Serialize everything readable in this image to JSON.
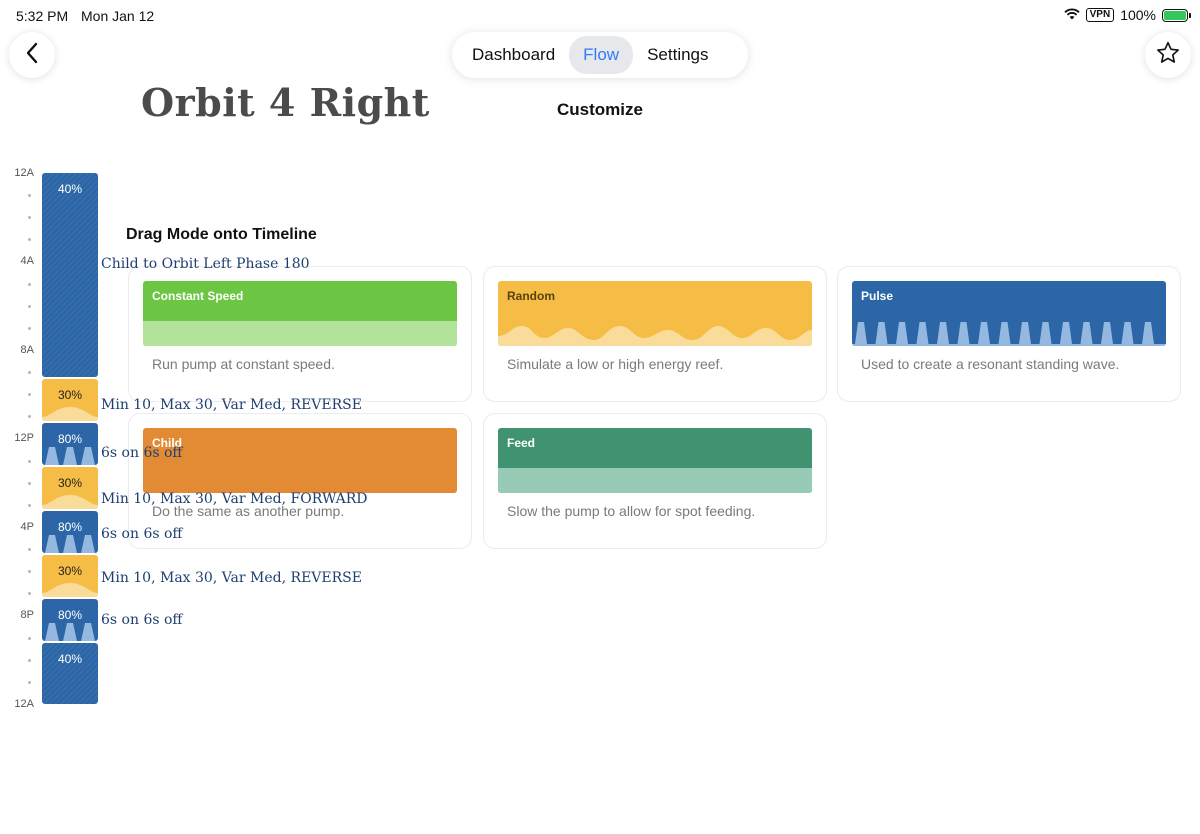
{
  "status_bar": {
    "time": "5:32 PM",
    "date": "Mon Jan 12",
    "vpn": "VPN",
    "battery": "100%",
    "icons": [
      "wifi-icon",
      "battery-charging-icon"
    ]
  },
  "nav": {
    "back_icon": "chevron-left-icon",
    "favorite_icon": "star-icon",
    "tabs": [
      {
        "label": "Dashboard",
        "active": false
      },
      {
        "label": "Flow",
        "active": true
      },
      {
        "label": "Settings",
        "active": false
      }
    ]
  },
  "page": {
    "title": "Orbit 4 Right",
    "subtitle": "Customize"
  },
  "timeline": {
    "axis_labels": [
      "12A",
      "4A",
      "8A",
      "12P",
      "4P",
      "8P",
      "12A"
    ],
    "segments": [
      {
        "mode": "constant",
        "percent": "40%",
        "description": "Child to Orbit Left Phase 180"
      },
      {
        "mode": "random",
        "percent": "30%",
        "description": "Min 10, Max 30, Var Med, REVERSE"
      },
      {
        "mode": "pulse",
        "percent": "80%",
        "description": "6s on 6s off"
      },
      {
        "mode": "random",
        "percent": "30%",
        "description": "Min 10, Max 30, Var Med, FORWARD"
      },
      {
        "mode": "pulse",
        "percent": "80%",
        "description": "6s on 6s off"
      },
      {
        "mode": "random",
        "percent": "30%",
        "description": "Min 10, Max 30, Var Med, REVERSE"
      },
      {
        "mode": "pulse",
        "percent": "80%",
        "description": "6s on 6s off"
      },
      {
        "mode": "constant",
        "percent": "40%",
        "description": ""
      }
    ]
  },
  "modes": {
    "heading": "Drag Mode onto Timeline",
    "cards": [
      {
        "name": "Constant Speed",
        "description": "Run pump at constant speed.",
        "color": "#6cc644",
        "secondary_color": "#b3e29a"
      },
      {
        "name": "Random",
        "description": "Simulate a low or high energy reef.",
        "color": "#f5bd45",
        "secondary_color": "#f9dc9a"
      },
      {
        "name": "Pulse",
        "description": "Used to create a resonant standing wave.",
        "color": "#2c66a7",
        "secondary_color": "#94b8e0"
      },
      {
        "name": "Child",
        "description": "Do the same as another pump.",
        "color": "#e38b34",
        "secondary_color": "#e38b34"
      },
      {
        "name": "Feed",
        "description": "Slow the pump to allow for spot feeding.",
        "color": "#409370",
        "secondary_color": "#98cbb5"
      }
    ]
  }
}
